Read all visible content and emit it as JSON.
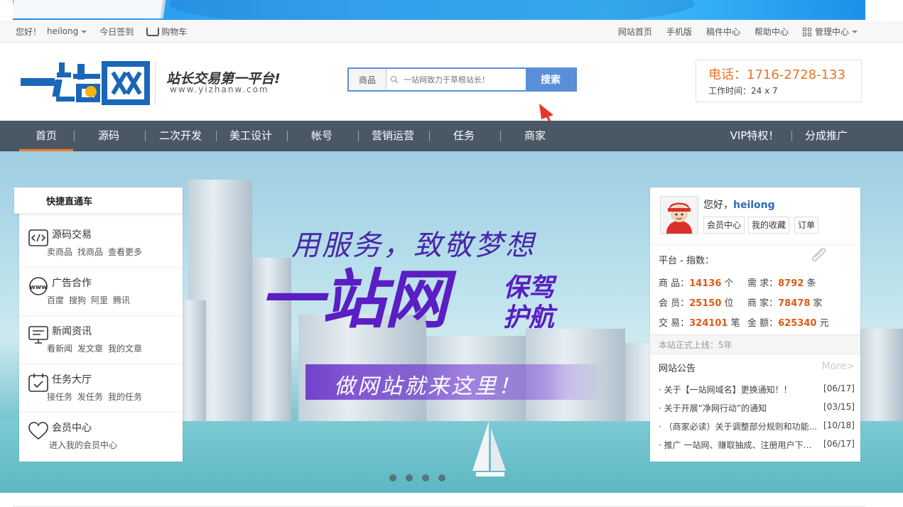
{
  "top_bar": {
    "greeting": "您好！",
    "username": "heilong",
    "checkin": "今日签到",
    "cart": "购物车",
    "links": [
      "网站首页",
      "手机版",
      "稿件中心",
      "帮助中心"
    ],
    "admin": "管理中心"
  },
  "header": {
    "logo_text": "一站网",
    "slogan": "站长交易第一平台!",
    "domain": "www.yizhanw.com",
    "search": {
      "category": "商品",
      "placeholder": "一站网致力于草根站长！",
      "button": "搜索"
    },
    "phone": "电话：1716-2728-133",
    "work_hours": "工作时间：24 x 7"
  },
  "nav": {
    "items": [
      "首页",
      "源码",
      "二次开发",
      "美工设计",
      "帐号",
      "营销运营",
      "任务",
      "商家"
    ],
    "right_items": [
      "VIP特权！",
      "分成推广"
    ],
    "active": "首页"
  },
  "hero": {
    "line1": "用服务，致敬梦想",
    "line2": "一站网",
    "line3a": "保驾",
    "line3b": "护航",
    "line4": "做网站就来这里！"
  },
  "quick": {
    "title": "快捷直通车",
    "items": [
      {
        "name": "源码交易",
        "icon": "code-icon",
        "links": [
          "卖商品",
          "找商品",
          "查看更多"
        ]
      },
      {
        "name": "广告合作",
        "icon": "www-icon",
        "links": [
          "百度",
          "搜狗",
          "阿里",
          "腾讯"
        ]
      },
      {
        "name": "新闻资讯",
        "icon": "monitor-icon",
        "links": [
          "看新闻",
          "发文章",
          "我的文章"
        ]
      },
      {
        "name": "任务大厅",
        "icon": "calendar-icon",
        "links": [
          "接任务",
          "发任务",
          "我的任务"
        ]
      },
      {
        "name": "会员中心",
        "icon": "heart-icon",
        "links": [
          "进入我的会员中心"
        ]
      }
    ]
  },
  "user_panel": {
    "hello": "您好，",
    "username": "heilong",
    "buttons": [
      "会员中心",
      "我的收藏",
      "订单"
    ],
    "stats_title": "平台 - 指数：",
    "stats": [
      {
        "label": "商 品：",
        "value": "14136",
        "unit": "个"
      },
      {
        "label": "需 求：",
        "value": "8792",
        "unit": "条"
      },
      {
        "label": "会 员：",
        "value": "25150",
        "unit": "位"
      },
      {
        "label": "商 家：",
        "value": "78478",
        "unit": "家"
      },
      {
        "label": "交 易：",
        "value": "324101",
        "unit": "笔"
      },
      {
        "label": "金 额：",
        "value": "625340",
        "unit": "元"
      }
    ],
    "online": "本站正式上线：5年",
    "notice_title": "网站公告",
    "more": "More>",
    "notices": [
      {
        "text": "· 关于【一站网域名】更换通知！！",
        "date": "[06/17]"
      },
      {
        "text": "· 关于开展“净网行动”的通知",
        "date": "[03/15]"
      },
      {
        "text": "· （商家必读）关于调整部分规则和功能...",
        "date": "[10/18]"
      },
      {
        "text": "· 推广 一站网、赚取抽成、注册用户下单...",
        "date": "[06/17]"
      }
    ]
  },
  "colors": {
    "nav_bg": "#4a5866",
    "accent": "#f37b1d",
    "brand": "#1a66b8",
    "search": "#5a8ed8"
  }
}
